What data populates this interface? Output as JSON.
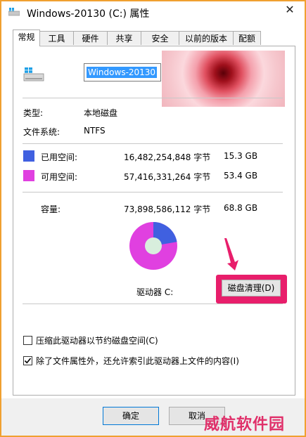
{
  "window": {
    "title": "Windows-20130 (C:) 属性",
    "close_glyph": "✕"
  },
  "tabs": [
    {
      "label": "常规",
      "active": true
    },
    {
      "label": "工具"
    },
    {
      "label": "硬件"
    },
    {
      "label": "共享"
    },
    {
      "label": "安全"
    },
    {
      "label": "以前的版本"
    },
    {
      "label": "配额"
    }
  ],
  "drive": {
    "name_value": "Windows-20130"
  },
  "info": {
    "type_label": "类型:",
    "type_value": "本地磁盘",
    "fs_label": "文件系统:",
    "fs_value": "NTFS"
  },
  "space": {
    "used_label": "已用空间:",
    "used_bytes": "16,482,254,848 字节",
    "used_gb": "15.3 GB",
    "used_color": "#4060e0",
    "free_label": "可用空间:",
    "free_bytes": "57,416,331,264 字节",
    "free_gb": "53.4 GB",
    "free_color": "#e040e0",
    "capacity_label": "容量:",
    "capacity_bytes": "73,898,586,112 字节",
    "capacity_gb": "68.8 GB",
    "used_fraction": 0.223
  },
  "drive_label": "驱动器 C:",
  "cleanup_button": "磁盘清理(D)",
  "options": {
    "compress_label": "压缩此驱动器以节约磁盘空间(C)",
    "compress_checked": false,
    "index_label": "除了文件属性外，还允许索引此驱动器上文件的内容(I)",
    "index_checked": true
  },
  "buttons": {
    "ok": "确定",
    "cancel": "取消"
  },
  "watermark": "威航软件园"
}
